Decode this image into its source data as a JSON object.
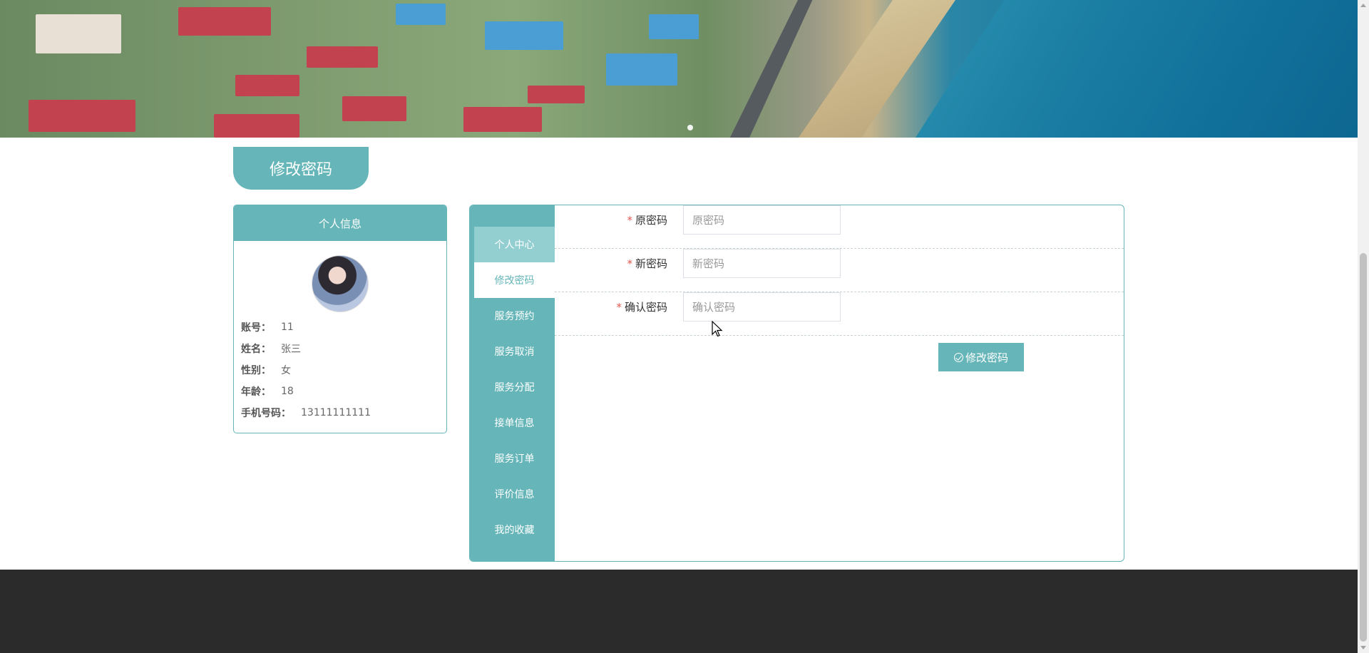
{
  "page": {
    "title": "修改密码"
  },
  "profile": {
    "header": "个人信息",
    "fields": [
      {
        "label": "账号：",
        "value": "11"
      },
      {
        "label": "姓名：",
        "value": "张三"
      },
      {
        "label": "性别：",
        "value": "女"
      },
      {
        "label": "年龄：",
        "value": "18"
      },
      {
        "label": "手机号码：",
        "value": "13111111111"
      }
    ]
  },
  "menu": {
    "items": [
      {
        "label": "个人中心"
      },
      {
        "label": "修改密码"
      },
      {
        "label": "服务预约"
      },
      {
        "label": "服务取消"
      },
      {
        "label": "服务分配"
      },
      {
        "label": "接单信息"
      },
      {
        "label": "服务订单"
      },
      {
        "label": "评价信息"
      },
      {
        "label": "我的收藏"
      }
    ],
    "active_index": 1,
    "highlight_index": 0
  },
  "form": {
    "fields": [
      {
        "label": "原密码",
        "placeholder": "原密码",
        "required": true
      },
      {
        "label": "新密码",
        "placeholder": "新密码",
        "required": true
      },
      {
        "label": "确认密码",
        "placeholder": "确认密码",
        "required": true
      }
    ],
    "submit_label": "修改密码"
  },
  "colors": {
    "accent": "#66b6b9",
    "footer": "#2b2b2b"
  },
  "icons": {
    "submit": "check-circle-icon"
  }
}
